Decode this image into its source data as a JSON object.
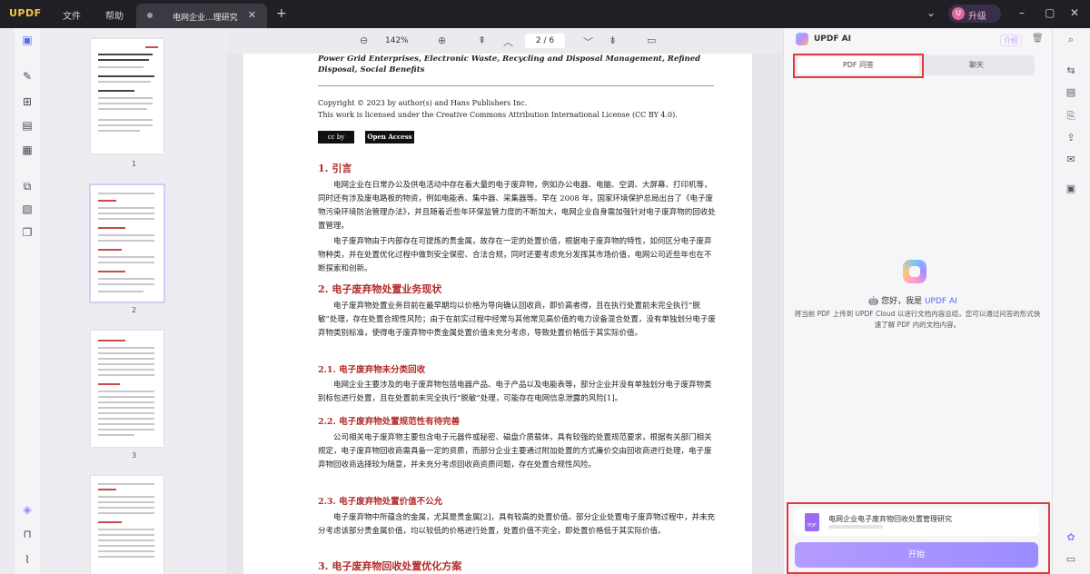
{
  "app": {
    "logo_main": "UPDF",
    "menu_file": "文件",
    "menu_help": "帮助",
    "upgrade": "升级",
    "avatar_letter": "U"
  },
  "tabs": [
    {
      "label": "电网企业...理研究"
    }
  ],
  "toolbar": {
    "zoom": "142%",
    "page_current": "2",
    "page_sep": "/",
    "page_total": "6"
  },
  "thumbnails": [
    {
      "num": "1"
    },
    {
      "num": "2"
    },
    {
      "num": "3"
    }
  ],
  "document": {
    "title_tail": "Power Grid Enterprises, Electronic Waste, Recycling and Disposal Management, Refined Disposal, Social Benefits",
    "copyright": "Copyright © 2023 by author(s) and Hans Publishers Inc.",
    "license": "This work is licensed under the Creative Commons Attribution International License (CC BY 4.0).",
    "open_access": "Open Access",
    "sec1": "1. 引言",
    "sec1_p1": "电网企业在日常办公及供电活动中存在着大量的电子废弃物，例如办公电器、电脑、空调、大屏幕、打印机等，同时还有涉及废电路板的物资，例如电能表、集中器、采集器等。早在 2008 年，国家环境保护总局出台了《电子废物污染环境防治管理办法》，并且随着近些年环保监管力度的不断加大，电网企业自身需加强针对电子废弃物的回收处置管理。",
    "sec1_p2": "电子废弃物由于内部存在可提炼的贵金属，故存在一定的处置价值，根据电子废弃物的特性，如何区分电子废弃物种类，并在处置优化过程中做到安全保密、合法合规，同时还要考虑充分发挥其市场价值，电网公司近些年也在不断探索和创新。",
    "sec2": "2. 电子废弃物处置业务现状",
    "sec2_p1": "电子废弃物处置业务目前在最早期均以价格为导向确认回收商，即价高者得，且在执行处置前未完全执行“脱敏”处理，存在处置合规性风险；由于在前实过程中经常与其他常见高价值的电力设备混合处置，没有单独划分电子废弃物类别标准，使得电子废弃物中贵金属处置价值未充分考虑，导致处置价格低于其实际价值。",
    "sec21": "2.1. 电子废弃物未分类回收",
    "sec21_p1": "电网企业主要涉及的电子废弃物包括电器产品、电子产品以及电能表等，部分企业并没有单独划分电子废弃物类别标包进行处置，且在处置前未完全执行“脱敏”处理，可能存在电网信息泄露的风险[1]。",
    "sec22": "2.2. 电子废弃物处置规范性有待完善",
    "sec22_p1": "公司相关电子废弃物主要包含电子元器件或秘密、磁盘介质载体，具有较强的处置规范要求，根据有关部门相关规定，电子废弃物回收商需具备一定的资质，而部分企业主要通过附加处置的方式廉价交由回收商进行处理，电子废弃物回收商选择较为随意，并未充分考虑回收商资质问题，存在处置合规性风险。",
    "sec23": "2.3. 电子废弃物处置价值不公允",
    "sec23_p1": "电子废弃物中所蕴含的金属，尤其是贵金属[2]，具有较高的处置价值。部分企业处置电子废弃物过程中，并未充分考虑该部分贵金属价值，均以较低的价格进行处置，处置价值不完全，即处置价格低于其实际价值。",
    "sec3": "3. 电子废弃物回收处置优化方案"
  },
  "ai_panel": {
    "title": "UPDF AI",
    "tab_pdf": "PDF 问答",
    "tab_chat": "聊天",
    "welcome_prefix": "您好，我是",
    "welcome_brand": "UPDF AI",
    "description": "将当前 PDF 上传到 UPDF Cloud 以进行文档内容总结，您可以通过问答的形式快速了解 PDF 内的文档内容。",
    "file_name": "电网企业电子废弃物回收处置管理研究",
    "pdf_badge": "PDF",
    "start": "开始",
    "mini_label": "介绍"
  }
}
